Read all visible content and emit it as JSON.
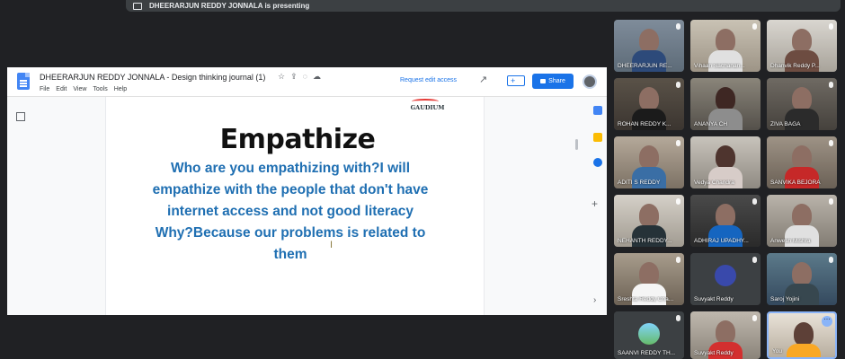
{
  "meet": {
    "presenting_label": "DHEERARJUN REDDY JONNALA is presenting"
  },
  "docs": {
    "title": "DHEERARJUN REDDY JONNALA - Design thinking journal (1)",
    "menu": [
      "File",
      "Edit",
      "View",
      "Tools",
      "Help"
    ],
    "request_edit": "Request edit access",
    "share_label": "Share",
    "add_label": "+",
    "brand_color": "#1a73e8"
  },
  "document": {
    "logo_name": "GAUDIUM",
    "heading": "Empathize",
    "body": "Who are you empathizing with?I will empathize with the people that don't have internet access and not good literacy Why?Because our problems is related to them",
    "body_color": "#1f6fb2"
  },
  "participants": [
    {
      "name": "DHEERARJUN RE..."
    },
    {
      "name": "Vihaan Sachanan..."
    },
    {
      "name": "Dhanvik Reddy P..."
    },
    {
      "name": "ROHAN REDDY K..."
    },
    {
      "name": "ANANYA CH"
    },
    {
      "name": "ZIVA BAGA"
    },
    {
      "name": "ADITI S REDDY"
    },
    {
      "name": "Vedya Chandra"
    },
    {
      "name": "SANVIKA BEJORA"
    },
    {
      "name": "NEHANTH REDDY..."
    },
    {
      "name": "ADHIRAJ UPADHY..."
    },
    {
      "name": "Anwesh Mishra"
    },
    {
      "name": "Sreshta Reddy Cha..."
    },
    {
      "name": "Suvyakt Reddy"
    },
    {
      "name": "Saroj Yojini"
    },
    {
      "name": "SAANVI REDDY TH..."
    },
    {
      "name": "Suvyakt Reddy"
    },
    {
      "name": "You"
    }
  ]
}
